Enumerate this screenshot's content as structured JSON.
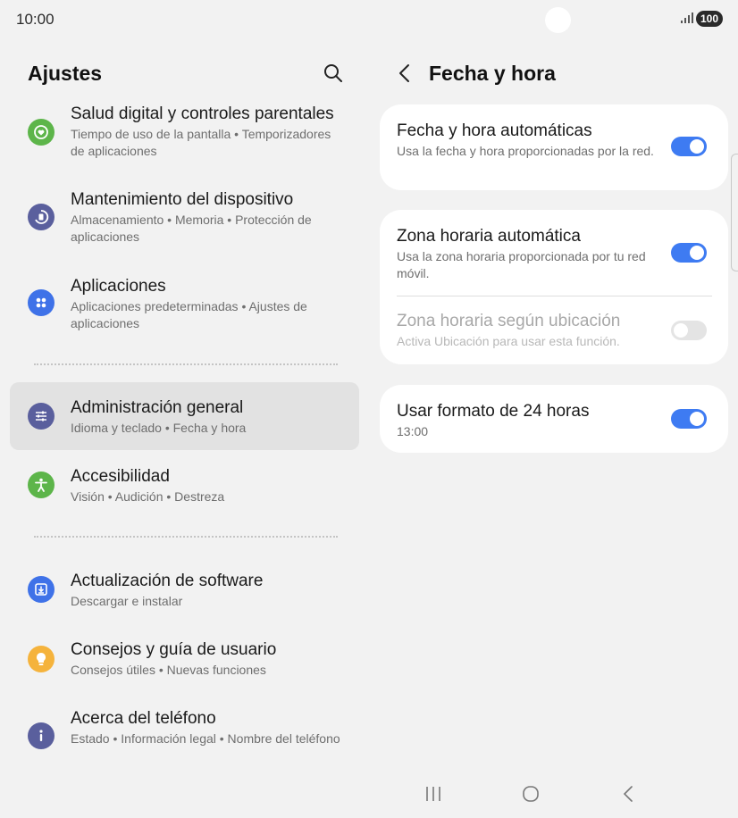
{
  "status": {
    "time": "10:00",
    "battery": "100"
  },
  "left": {
    "title": "Ajustes",
    "items": [
      {
        "title": "Salud digital y controles parentales",
        "subtitle": "Tiempo de uso de la pantalla  •  Temporizadores de aplicaciones",
        "icon": "digital-wellbeing-icon",
        "color": "#5db54a"
      },
      {
        "title": "Mantenimiento del dispositivo",
        "subtitle": "Almacenamiento  •  Memoria  •  Protección de aplicaciones",
        "icon": "device-care-icon",
        "color": "#5a5f9d"
      },
      {
        "title": "Aplicaciones",
        "subtitle": "Aplicaciones predeterminadas  •  Ajustes de aplicaciones",
        "icon": "apps-icon",
        "color": "#3f72e8"
      },
      {
        "title": "Administración general",
        "subtitle": "Idioma y teclado  •  Fecha y hora",
        "icon": "general-management-icon",
        "color": "#5a5f9d"
      },
      {
        "title": "Accesibilidad",
        "subtitle": "Visión  •  Audición  •  Destreza",
        "icon": "accessibility-icon",
        "color": "#5db54a"
      },
      {
        "title": "Actualización de software",
        "subtitle": "Descargar e instalar",
        "icon": "software-update-icon",
        "color": "#3f72e8"
      },
      {
        "title": "Consejos y guía de usuario",
        "subtitle": "Consejos útiles  •  Nuevas funciones",
        "icon": "tips-icon",
        "color": "#f5b33c"
      },
      {
        "title": "Acerca del teléfono",
        "subtitle": "Estado  •  Información legal  •  Nombre del teléfono",
        "icon": "info-icon",
        "color": "#5a5f9d"
      }
    ]
  },
  "right": {
    "title": "Fecha y hora",
    "settings": [
      {
        "title": "Fecha y hora automáticas",
        "subtitle": "Usa la fecha y hora proporcionadas por la red.",
        "enabled": true,
        "on": true
      },
      {
        "title": "Zona horaria automática",
        "subtitle": "Usa la zona horaria proporcionada por tu red móvil.",
        "enabled": true,
        "on": true
      },
      {
        "title": "Zona horaria según ubicación",
        "subtitle": "Activa Ubicación para usar esta función.",
        "enabled": false,
        "on": false
      },
      {
        "title": "Usar formato de 24 horas",
        "subtitle": "13:00",
        "enabled": true,
        "on": true
      }
    ]
  },
  "colors": {
    "accent": "#3e7bf2",
    "background": "#f2f2f2",
    "card": "#ffffff"
  }
}
